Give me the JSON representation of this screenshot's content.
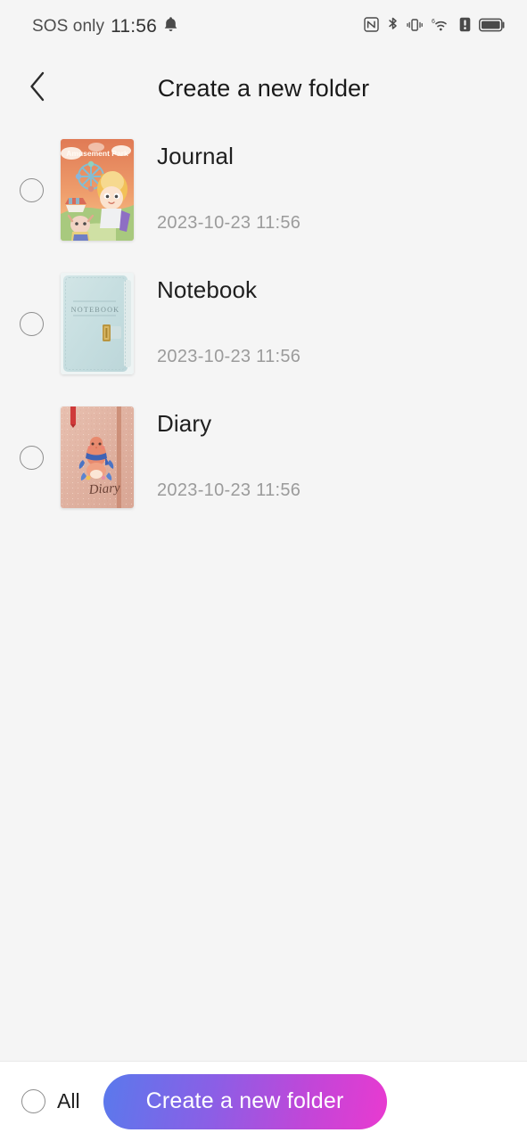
{
  "statusbar": {
    "carrier": "SOS only",
    "time": "11:56",
    "icons": [
      {
        "name": "bell-icon"
      },
      {
        "name": "nfc-icon"
      },
      {
        "name": "bluetooth-icon"
      },
      {
        "name": "vibrate-icon"
      },
      {
        "name": "wifi-6-icon"
      },
      {
        "name": "alert-icon"
      },
      {
        "name": "battery-icon"
      }
    ],
    "wifi_label": "6"
  },
  "header": {
    "title": "Create a new folder",
    "back_icon": "chevron-left-icon"
  },
  "list": {
    "items": [
      {
        "name": "Journal",
        "time": "2023-10-23 11:56",
        "selected": false,
        "cover": {
          "style": "amusement-park",
          "title": "Amusement Park",
          "bg": "#e8825e",
          "accent": "#f5c451"
        }
      },
      {
        "name": "Notebook",
        "time": "2023-10-23 11:56",
        "selected": false,
        "cover": {
          "style": "notebook",
          "title": "NOTEBOOK",
          "bg": "#c7dee1",
          "accent": "#b8a16a"
        }
      },
      {
        "name": "Diary",
        "time": "2023-10-23 11:56",
        "selected": false,
        "cover": {
          "style": "diary",
          "title": "Diary",
          "bg": "#e3b3a3",
          "accent": "#c9553f"
        }
      }
    ]
  },
  "bottombar": {
    "all_label": "All",
    "all_selected": false,
    "cta_label": "Create a new folder",
    "cta_gradient_start": "#5a79ec",
    "cta_gradient_end": "#e93ad0"
  }
}
